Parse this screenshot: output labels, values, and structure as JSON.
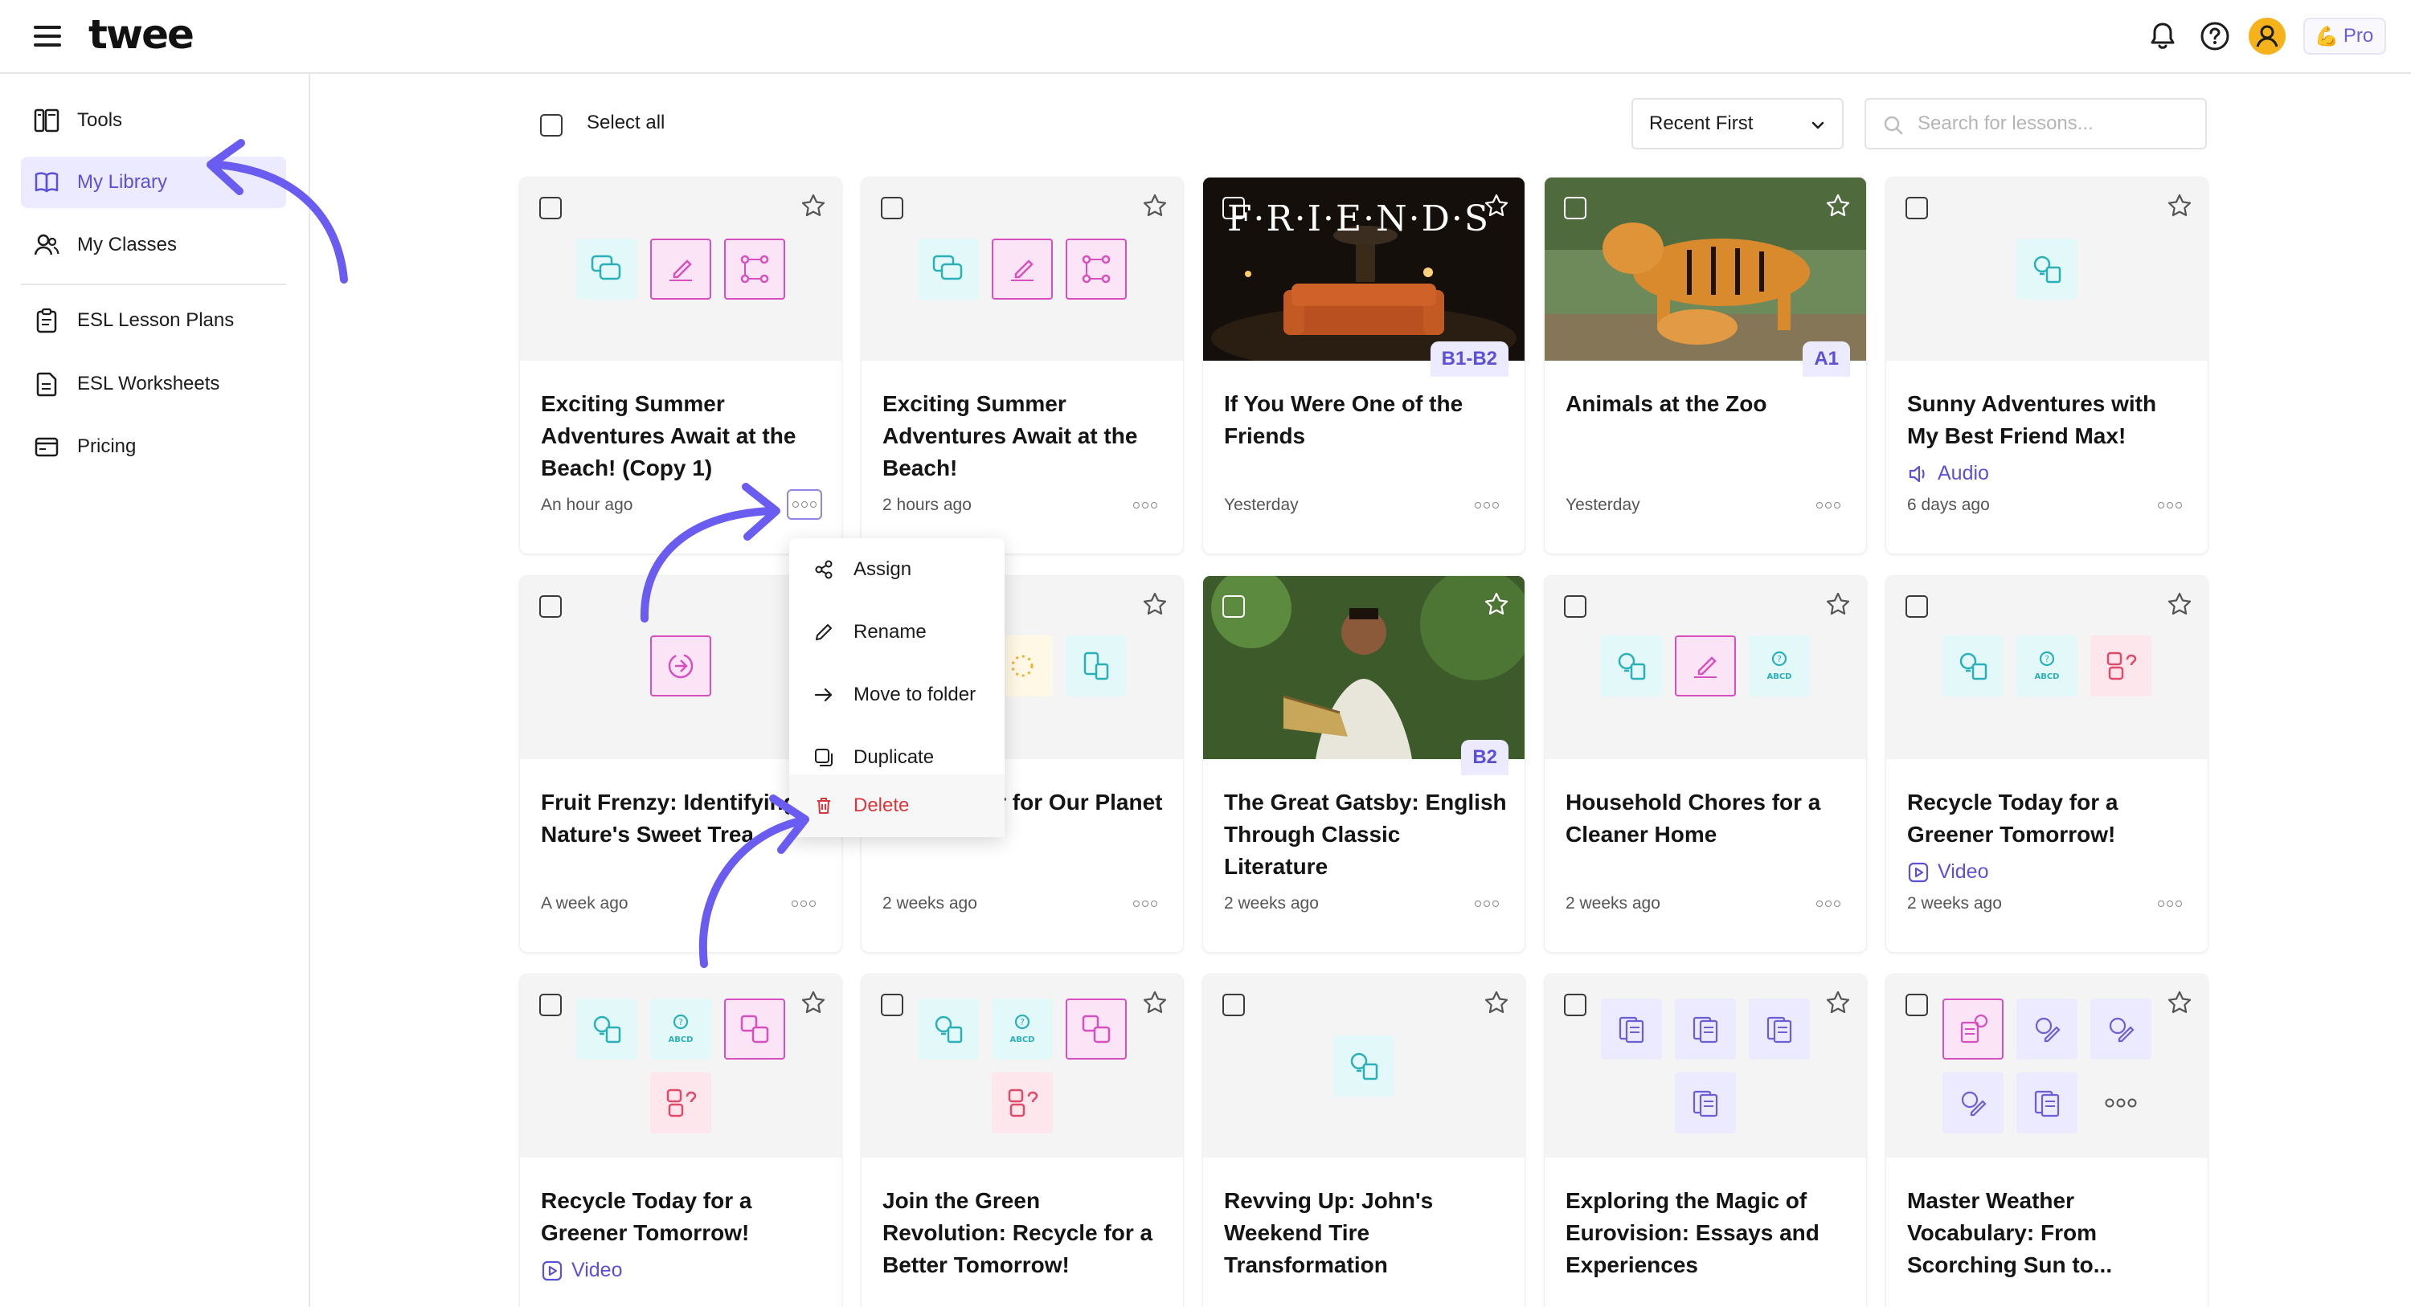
{
  "app": {
    "logo": "twee",
    "pro_label": "Pro"
  },
  "sidebar": {
    "items": [
      {
        "label": "Tools",
        "icon": "tools-icon"
      },
      {
        "label": "My Library",
        "icon": "library-icon",
        "active": true
      },
      {
        "label": "My Classes",
        "icon": "classes-icon"
      },
      {
        "label": "ESL Lesson Plans",
        "icon": "lesson-plans-icon"
      },
      {
        "label": "ESL Worksheets",
        "icon": "worksheets-icon"
      },
      {
        "label": "Pricing",
        "icon": "pricing-icon"
      }
    ]
  },
  "toolbar": {
    "select_all": "Select all",
    "sort_value": "Recent First",
    "search_placeholder": "Search for lessons..."
  },
  "cards": [
    {
      "title": "Exciting Summer Adventures Await at the Beach! (Copy 1)",
      "time": "An hour ago"
    },
    {
      "title": "Exciting Summer Adventures Await at the Beach!",
      "time": "2 hours ago"
    },
    {
      "title": "If You Were One of the Friends",
      "time": "Yesterday",
      "level": "B1-B2",
      "photo_text": "F·R·I·E·N·D·S"
    },
    {
      "title": "Animals at the Zoo",
      "time": "Yesterday",
      "level": "A1"
    },
    {
      "title": "Sunny Adventures with My Best Friend Max!",
      "time": "6 days ago",
      "media": "Audio"
    },
    {
      "title": "Fruit Frenzy: Identifying Nature's Sweet Trea",
      "time": "A week ago"
    },
    {
      "title": "roes: Why r for Our Planet",
      "time": "2 weeks ago"
    },
    {
      "title": "The Great Gatsby: English Through Classic Literature",
      "time": "2 weeks ago",
      "level": "B2"
    },
    {
      "title": "Household Chores for a Cleaner Home",
      "time": "2 weeks ago"
    },
    {
      "title": "Recycle Today for a Greener Tomorrow!",
      "time": "2 weeks ago",
      "media": "Video"
    },
    {
      "title": "Recycle Today for a Greener Tomorrow!",
      "media": "Video"
    },
    {
      "title": "Join the Green Revolution: Recycle for a Better Tomorrow!"
    },
    {
      "title": "Revving Up: John's Weekend Tire Transformation"
    },
    {
      "title": "Exploring the Magic of Eurovision: Essays and Experiences"
    },
    {
      "title": "Master Weather Vocabulary: From Scorching Sun to..."
    }
  ],
  "context_menu": {
    "items": [
      {
        "label": "Assign",
        "icon": "share-icon"
      },
      {
        "label": "Rename",
        "icon": "pencil-icon"
      },
      {
        "label": "Move to folder",
        "icon": "arrow-right-icon"
      },
      {
        "label": "Duplicate",
        "icon": "duplicate-icon"
      },
      {
        "label": "Delete",
        "icon": "trash-icon",
        "danger": true
      }
    ]
  },
  "colors": {
    "accent": "#5b50d6",
    "annotation_arrow": "#6a5cf0",
    "danger": "#d9363e",
    "avatar": "#f6b21b"
  }
}
